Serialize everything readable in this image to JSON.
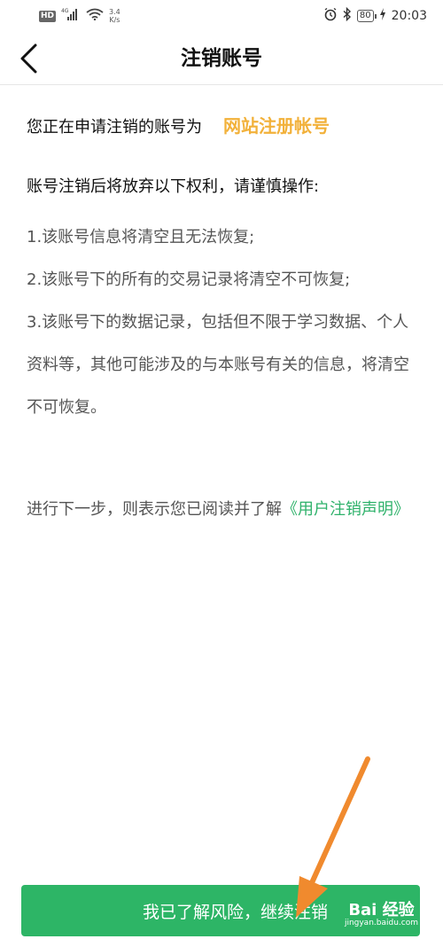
{
  "status_bar": {
    "hd": "HD",
    "network": "4G",
    "speed_value": "3.4",
    "speed_unit": "K/s",
    "battery": "80",
    "time": "20:03"
  },
  "header": {
    "title": "注销账号"
  },
  "intro": {
    "text": "您正在申请注销的账号为",
    "account": "网站注册帐号"
  },
  "warning": {
    "title": "账号注销后将放弃以下权利，请谨慎操作:",
    "items": [
      "1.该账号信息将清空且无法恢复;",
      "2.该账号下的所有的交易记录将清空不可恢复;",
      "3.该账号下的数据记录，包括但不限于学习数据、个人资料等，其他可能涉及的与本账号有关的信息，将清空不可恢复。"
    ]
  },
  "statement": {
    "text": "进行下一步，则表示您已阅读并了解",
    "link": "《用户注销声明》"
  },
  "footer": {
    "button_label": "我已了解风险，继续注销",
    "watermark_logo": "Bai 经验",
    "watermark_sub": "jingyan.baidu.com"
  },
  "colors": {
    "accent_green": "#2db566",
    "account_orange": "#f2b13a",
    "link_green": "#2fb26b",
    "arrow_orange": "#f08a2e"
  }
}
